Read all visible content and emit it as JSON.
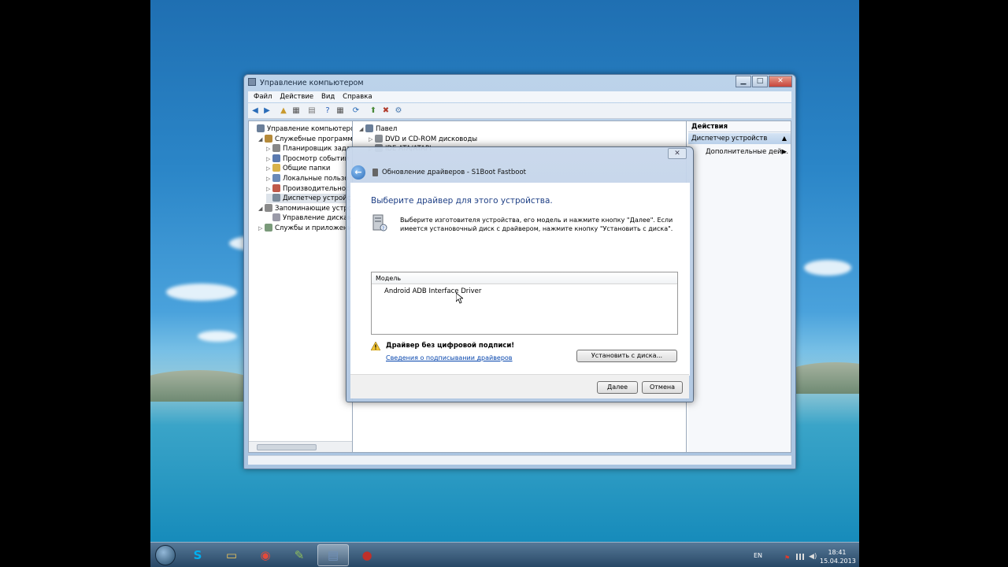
{
  "main_window": {
    "title": "Управление компьютером",
    "buttons": {
      "minimize": "▁",
      "maximize": "□",
      "close": "✕"
    },
    "menu": [
      "Файл",
      "Действие",
      "Вид",
      "Справка"
    ],
    "tree": [
      {
        "label": "Управление компьютером (л",
        "icon": "computer-icon",
        "indent": 0,
        "expander": ""
      },
      {
        "label": "Служебные программы",
        "icon": "tools-icon",
        "indent": 1,
        "expander": "◢"
      },
      {
        "label": "Планировщик задач",
        "icon": "clock-icon",
        "indent": 2,
        "expander": "▷"
      },
      {
        "label": "Просмотр событий",
        "icon": "event-viewer-icon",
        "indent": 2,
        "expander": "▷"
      },
      {
        "label": "Общие папки",
        "icon": "shared-folder-icon",
        "indent": 2,
        "expander": "▷"
      },
      {
        "label": "Локальные пользо",
        "icon": "users-icon",
        "indent": 2,
        "expander": "▷"
      },
      {
        "label": "Производительнос",
        "icon": "performance-icon",
        "indent": 2,
        "expander": "▷"
      },
      {
        "label": "Диспетчер устройст",
        "icon": "device-manager-icon",
        "indent": 2,
        "expander": "",
        "selected": true
      },
      {
        "label": "Запоминающие устрой",
        "icon": "storage-icon",
        "indent": 1,
        "expander": "◢"
      },
      {
        "label": "Управление дисками",
        "icon": "disk-icon",
        "indent": 2,
        "expander": ""
      },
      {
        "label": "Службы и приложения",
        "icon": "services-icon",
        "indent": 1,
        "expander": "▷"
      }
    ],
    "devices": [
      {
        "label": "Павел",
        "expander": "◢"
      },
      {
        "label": "DVD и CD-ROM дисководы",
        "expander": "▷"
      },
      {
        "label": "IDE ATA/ATAPI",
        "expander": "▷"
      }
    ],
    "actions": {
      "header": "Действия",
      "group": "Диспетчер устройств",
      "more": "Дополнительные дей…"
    }
  },
  "dialog": {
    "title": "Обновление драйверов - S1Boot Fastboot",
    "heading": "Выберите драйвер для этого устройства.",
    "description": "Выберите изготовителя устройства, его модель и нажмите кнопку \"Далее\". Если имеется установочный диск с драйвером, нажмите кнопку \"Установить с диска\".",
    "list_header": "Модель",
    "list_items": [
      "Android ADB Interface Driver"
    ],
    "warning": "Драйвер без цифровой подписи!",
    "warning_link": "Сведения о подписывании драйверов",
    "install_from_disk": "Установить с диска...",
    "next": "Далее",
    "cancel": "Отмена"
  },
  "taskbar": {
    "items": [
      {
        "name": "skype",
        "glyph": "S",
        "color": "#00aff0",
        "active": false
      },
      {
        "name": "explorer",
        "glyph": "▭",
        "color": "#e8c25a",
        "active": false
      },
      {
        "name": "chrome",
        "glyph": "◉",
        "color": "#e24a3b",
        "active": false
      },
      {
        "name": "notepad",
        "glyph": "✎",
        "color": "#8fbf5c",
        "active": false
      },
      {
        "name": "computer-management",
        "glyph": "▤",
        "color": "#6e8fb8",
        "active": true
      },
      {
        "name": "recorder",
        "glyph": "●",
        "color": "#c0302a",
        "active": false
      }
    ],
    "language": "EN",
    "time": "18:41",
    "date": "15.04.2013"
  }
}
